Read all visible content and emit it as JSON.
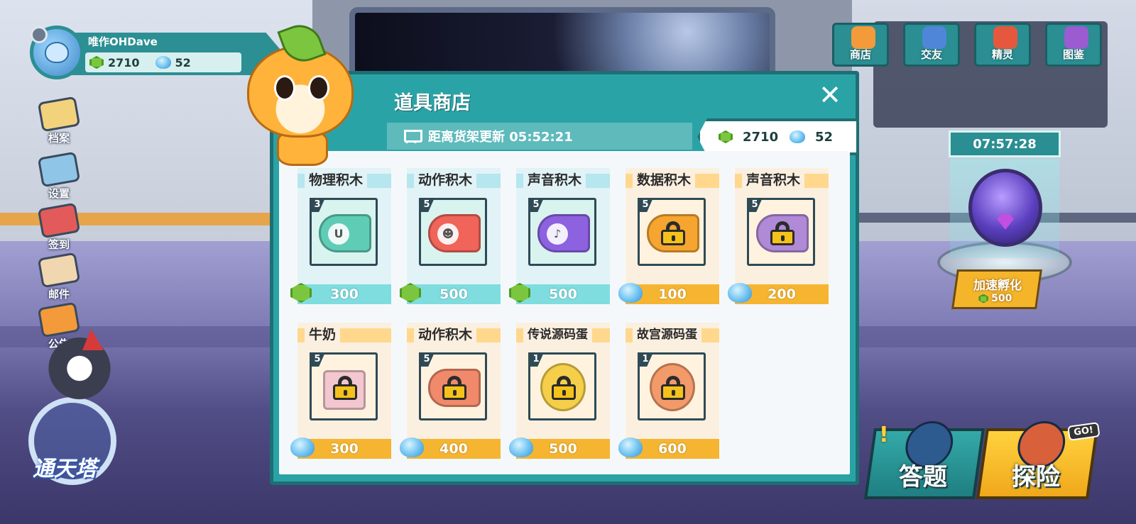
{
  "player": {
    "name": "唯作OHDave",
    "gems": "2710",
    "shells": "52"
  },
  "left_menu": [
    {
      "label": "档案",
      "icon": "profile-card-icon",
      "color": "#f3d27c"
    },
    {
      "label": "设置",
      "icon": "settings-icon",
      "color": "#8fc6e8"
    },
    {
      "label": "签到",
      "icon": "calendar-check-icon",
      "color": "#e35a5a"
    },
    {
      "label": "邮件",
      "icon": "mail-icon",
      "color": "#f0d7b0"
    },
    {
      "label": "公告",
      "icon": "megaphone-icon",
      "color": "#f39a3a"
    }
  ],
  "tower": {
    "label": "通天塔"
  },
  "top_nav": [
    {
      "label": "商店",
      "icon": "shop-icon",
      "color": "#f39a3a"
    },
    {
      "label": "交友",
      "icon": "chat-bubble-icon",
      "color": "#4f86d8"
    },
    {
      "label": "精灵",
      "icon": "creature-icon",
      "color": "#e5583d"
    },
    {
      "label": "图鉴",
      "icon": "book-icon",
      "color": "#9b5bd1"
    }
  ],
  "incubator": {
    "timer": "07:57:28",
    "button_label": "加速孵化",
    "cost": "500"
  },
  "shop": {
    "title": "道具商店",
    "refresh_text": "距离货架更新 05:52:21",
    "gems": "2710",
    "shells": "52",
    "items": [
      {
        "name": "物理积木",
        "qty": "3",
        "price": "300",
        "currency": "gem",
        "locked": false,
        "theme": "teal",
        "art_color": "#5fcdb6",
        "glyph": "U"
      },
      {
        "name": "动作积木",
        "qty": "5",
        "price": "500",
        "currency": "gem",
        "locked": false,
        "theme": "teal",
        "art_color": "#f0645a",
        "glyph": "☻"
      },
      {
        "name": "声音积木",
        "qty": "5",
        "price": "500",
        "currency": "gem",
        "locked": false,
        "theme": "teal",
        "art_color": "#8d62e0",
        "glyph": "♪"
      },
      {
        "name": "数据积木",
        "qty": "5",
        "price": "100",
        "currency": "shell",
        "locked": true,
        "theme": "gold",
        "art_color": "#f5a530",
        "glyph": ""
      },
      {
        "name": "声音积木",
        "qty": "5",
        "price": "200",
        "currency": "shell",
        "locked": true,
        "theme": "gold",
        "art_color": "#b08ad6",
        "glyph": ""
      },
      {
        "name": "牛奶",
        "qty": "5",
        "price": "300",
        "currency": "shell",
        "locked": true,
        "theme": "gold",
        "art_color": "#f3c7cf",
        "glyph": ""
      },
      {
        "name": "动作积木",
        "qty": "5",
        "price": "400",
        "currency": "shell",
        "locked": true,
        "theme": "gold",
        "art_color": "#f08a6a",
        "glyph": ""
      },
      {
        "name": "传说源码蛋",
        "qty": "1",
        "price": "500",
        "currency": "shell",
        "locked": true,
        "theme": "gold",
        "art_color": "#f5cf4a",
        "glyph": ""
      },
      {
        "name": "故宫源码蛋",
        "qty": "1",
        "price": "600",
        "currency": "shell",
        "locked": true,
        "theme": "gold",
        "art_color": "#f29a6a",
        "glyph": ""
      }
    ]
  },
  "bottom_buttons": {
    "quiz_label": "答题",
    "explore_label": "探险",
    "go_tag": "GO!",
    "alert": "!"
  }
}
